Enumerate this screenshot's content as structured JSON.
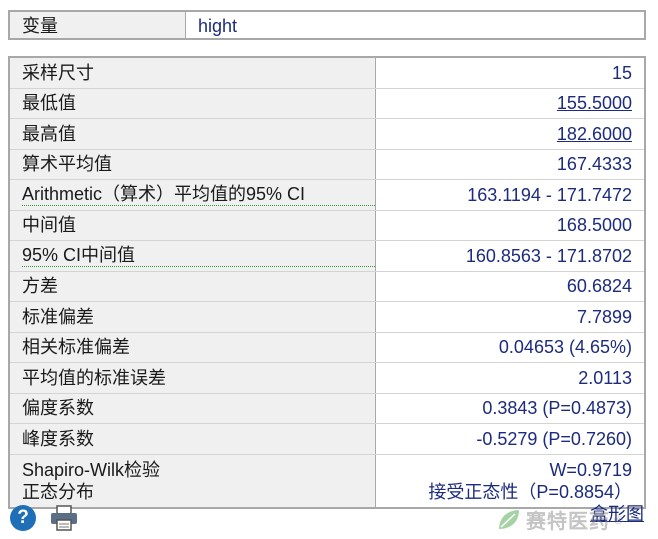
{
  "variable": {
    "label": "变量",
    "value": "hight"
  },
  "stats": [
    {
      "label": "采样尺寸",
      "value": "15"
    },
    {
      "label": "最低值",
      "value": "155.5000"
    },
    {
      "label": "最高值",
      "value": "182.6000"
    },
    {
      "label": "算术平均值",
      "value": "167.4333"
    },
    {
      "label": "Arithmetic（算术）平均值的95% CI",
      "value": "163.1194 - 171.7472"
    },
    {
      "label": "中间值",
      "value": "168.5000"
    },
    {
      "label": "95% CI中间值",
      "value": "160.8563 - 171.8702"
    },
    {
      "label": "方差",
      "value": "60.6824"
    },
    {
      "label": "标准偏差",
      "value": "7.7899"
    },
    {
      "label": "相关标准偏差",
      "value": "0.04653 (4.65%)"
    },
    {
      "label": "平均值的标准误差",
      "value": "2.0113"
    },
    {
      "label": "偏度系数",
      "value": "0.3843 (P=0.4873)"
    },
    {
      "label": "峰度系数",
      "value": "-0.5279 (P=0.7260)"
    }
  ],
  "normality": {
    "label_line1": "Shapiro-Wilk检验",
    "label_line2": "正态分布",
    "value_line1": "W=0.9719",
    "value_line2": "接受正态性（P=0.8854）"
  },
  "footer": {
    "box_plot_link": "盒形图",
    "help_icon_glyph": "?",
    "watermark_text": "赛特医药",
    "watermark_mark": "®"
  },
  "colors": {
    "value_text": "#1c2b7f",
    "label_bg": "#f0f0f0",
    "help_icon": "#1f6fb8"
  }
}
